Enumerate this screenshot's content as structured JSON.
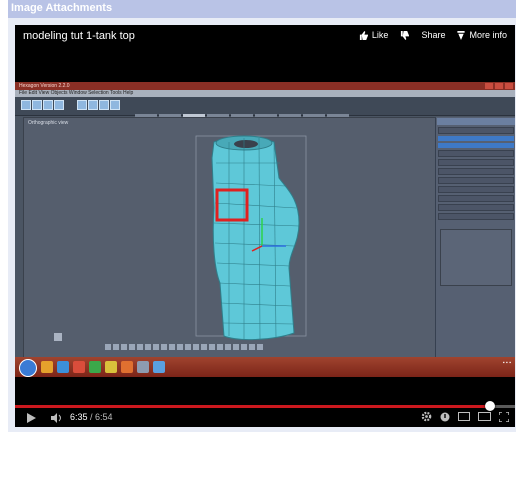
{
  "panel": {
    "title": "Image Attachments"
  },
  "video": {
    "title": "modeling tut 1-tank top",
    "actions": {
      "like": "Like",
      "dislike_icon": "thumbs-down-icon",
      "share": "Share",
      "more": "More info"
    },
    "current_time": "6:35",
    "separator": " / ",
    "duration": "6:54",
    "progress": 0.95,
    "colors": {
      "progress": "#cc181e",
      "model": "#5ec8d8",
      "highlight": "#e02020"
    }
  },
  "screen": {
    "app_title": "Hexagon Version 2.2.0",
    "menu": "File  Edit  View  Objects  Window  Selection  Tools  Help",
    "viewport_label": "Orthographic view"
  }
}
